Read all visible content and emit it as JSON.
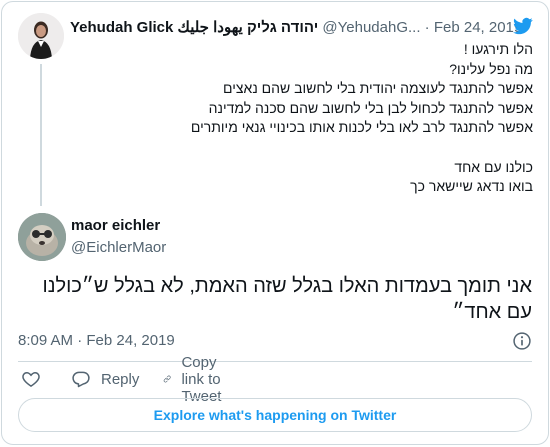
{
  "parent_tweet": {
    "author_name": "Yehudah Glick יהודה גליק يهودا جليك",
    "handle_date": "@YehudahG... · Feb 24, 2019",
    "lines": [
      "הלו תירגעו !",
      "מה נפל עלינו?",
      "אפשר להתנגד לעוצמה יהודית בלי לחשוב שהם נאצים",
      "אפשר להתנגד לכחול לבן בלי לחשוב שהם סכנה למדינה",
      "אפשר להתנגד לרב לאו בלי לכנות אותו בכינויי גנאי מיותרים",
      "",
      "כולנו עם אחד",
      "בואו נדאג שיישאר כך"
    ]
  },
  "reply_tweet": {
    "author_name": "maor eichler",
    "handle": "@EichlerMaor",
    "text": "אני תומך בעמדות האלו בגלל שזה האמת, לא בגלל ש״כולנו עם אחד״",
    "timestamp": "8:09 AM · Feb 24, 2019"
  },
  "actions": {
    "reply_label": "Reply",
    "copy_label": "Copy link to Tweet"
  },
  "explore_label": "Explore what's happening on Twitter",
  "colors": {
    "brand": "#1d9bf0",
    "text": "#0f1419",
    "secondary": "#536471",
    "border": "#cfd9de"
  },
  "icons": [
    "twitter-bird-icon",
    "info-icon",
    "heart-icon",
    "reply-icon",
    "link-icon"
  ]
}
